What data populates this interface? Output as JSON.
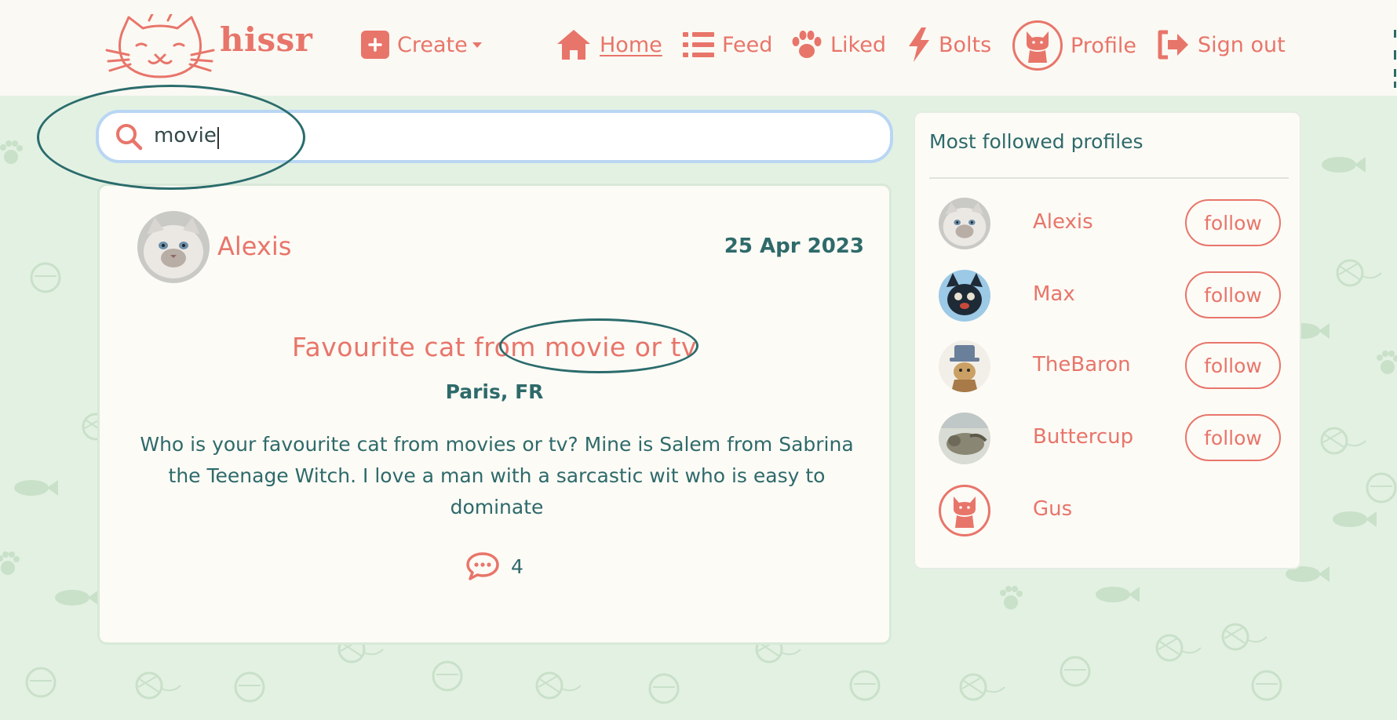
{
  "app": {
    "brand": "hissr"
  },
  "nav": {
    "create_label": "Create",
    "home_label": "Home",
    "feed_label": "Feed",
    "liked_label": "Liked",
    "bolts_label": "Bolts",
    "profile_label": "Profile",
    "signout_label": "Sign out"
  },
  "search": {
    "value": "movie"
  },
  "post": {
    "author": "Alexis",
    "date": "25 Apr 2023",
    "title": "Favourite cat from movie or tv",
    "location": "Paris, FR",
    "body": "Who is your favourite cat from movies or tv? Mine is Salem from Sabrina the Teenage Witch. I love a man with a sarcastic wit who is easy to dominate",
    "comment_count": "4"
  },
  "sidebar": {
    "title": "Most followed profiles",
    "profiles": [
      {
        "name": "Alexis",
        "follow_label": "follow"
      },
      {
        "name": "Max",
        "follow_label": "follow"
      },
      {
        "name": "TheBaron",
        "follow_label": "follow"
      },
      {
        "name": "Buttercup",
        "follow_label": "follow"
      },
      {
        "name": "Gus"
      }
    ]
  },
  "colors": {
    "accent": "#e8756a",
    "text_teal": "#2e6a6a",
    "background": "#e3f1e3",
    "card": "#fdfbf6"
  },
  "icons": {
    "logo": "cat-face-icon",
    "create": "plus-square-icon",
    "home": "home-icon",
    "feed": "list-icon",
    "liked": "paw-icon",
    "bolts": "bolt-icon",
    "profile": "cat-avatar-icon",
    "signout": "sign-out-icon",
    "search": "search-icon",
    "comments": "comment-dots-icon"
  }
}
